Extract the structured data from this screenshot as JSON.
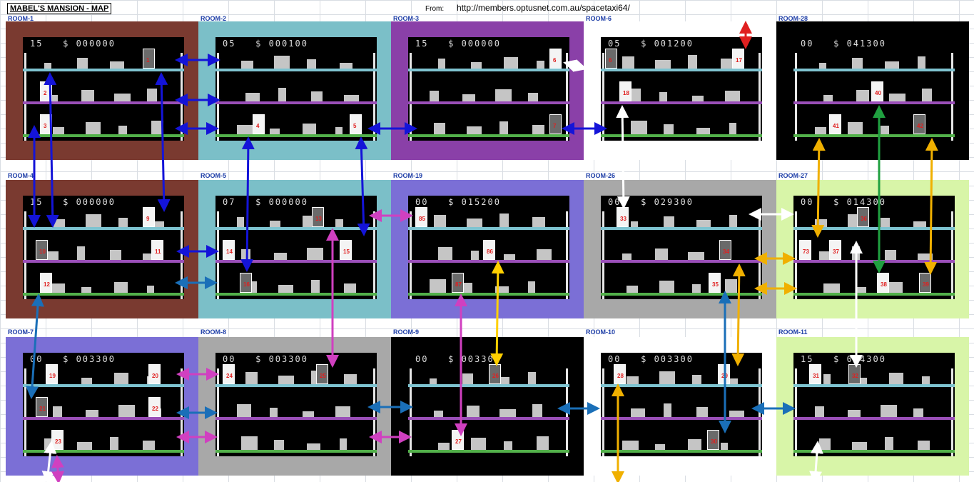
{
  "header": {
    "title": "MABEL'S MANSION - MAP",
    "from_label": "From:",
    "url": "http://members.optusnet.com.au/spacetaxi64/"
  },
  "colors": {
    "floor_top": "#7ec3d0",
    "floor_mid": "#9a4fb8",
    "floor_bottom": "#52b04a",
    "door_number": "#e02020"
  },
  "rooms": [
    {
      "label": "ROOM-1",
      "frame": "#7a3a30",
      "hud": "15   $ 000000",
      "doors": [
        "1",
        "2",
        "3"
      ]
    },
    {
      "label": "ROOM-2",
      "frame": "#7bbfc8",
      "hud": "05   $ 000100",
      "doors": [
        "4",
        "5"
      ]
    },
    {
      "label": "ROOM-3",
      "frame": "#8a40a8",
      "hud": "15   $ 000000",
      "doors": [
        "6",
        "7"
      ]
    },
    {
      "label": "ROOM-6",
      "frame": "#ffffff",
      "hud": "05   $ 001200",
      "doors": [
        "6",
        "17",
        "18"
      ]
    },
    {
      "label": "ROOM-28",
      "frame": "#000000",
      "hud": "00   $ 041300",
      "doors": [
        "40",
        "41",
        "42"
      ]
    },
    {
      "label": "ROOM-4",
      "frame": "#7a3a30",
      "hud": "15   $ 000000",
      "doors": [
        "9",
        "10",
        "11",
        "12"
      ]
    },
    {
      "label": "ROOM-5",
      "frame": "#7bbfc8",
      "hud": "07   $ 000000",
      "doors": [
        "13",
        "14",
        "15",
        "16"
      ]
    },
    {
      "label": "ROOM-19",
      "frame": "#7b6fd6",
      "hud": "00   $ 015200",
      "doors": [
        "85",
        "86",
        "87"
      ]
    },
    {
      "label": "ROOM-26",
      "frame": "#a8a8a8",
      "hud": "00   $ 029300",
      "doors": [
        "33",
        "34",
        "35"
      ]
    },
    {
      "label": "ROOM-27",
      "frame": "#d8f5a8",
      "hud": "00   $ 014300",
      "doors": [
        "36",
        "37",
        "38",
        "39",
        "73"
      ]
    },
    {
      "label": "ROOM-7",
      "frame": "#7b6fd6",
      "hud": "00   $ 003300",
      "doors": [
        "19",
        "20",
        "21",
        "22",
        "23"
      ]
    },
    {
      "label": "ROOM-8",
      "frame": "#a8a8a8",
      "hud": "00   $ 003300",
      "doors": [
        "24",
        "25"
      ]
    },
    {
      "label": "ROOM-9",
      "frame": "#000000",
      "hud": "00   $ 003300",
      "doors": [
        "26",
        "27"
      ]
    },
    {
      "label": "ROOM-10",
      "frame": "#ffffff",
      "hud": "00   $ 003300",
      "doors": [
        "28",
        "29",
        "30"
      ]
    },
    {
      "label": "ROOM-11",
      "frame": "#d8f5a8",
      "hud": "15   $ 014300",
      "doors": [
        "31",
        "32"
      ]
    }
  ]
}
